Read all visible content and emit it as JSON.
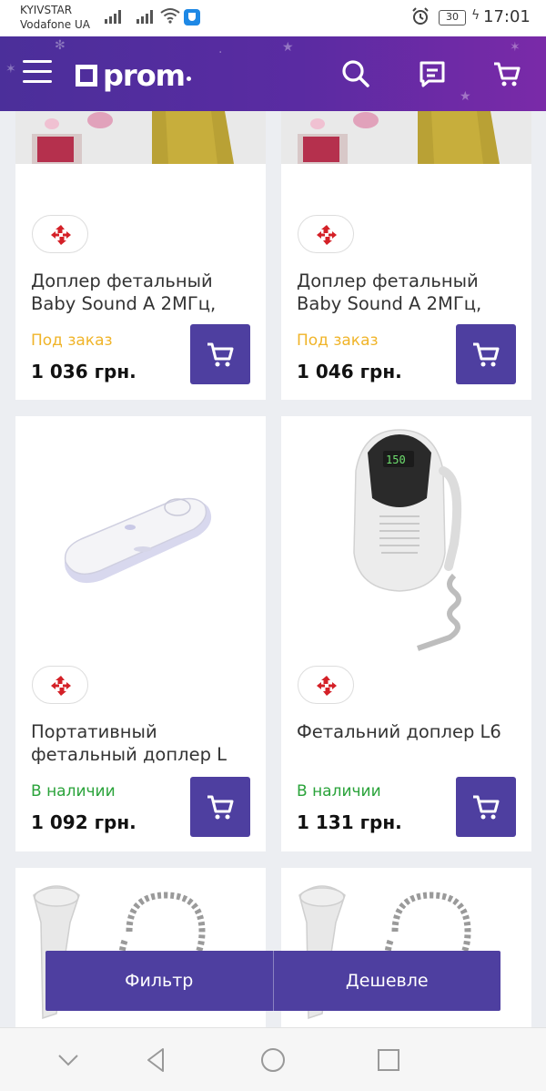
{
  "status_bar": {
    "carrier_1": "KYIVSTAR",
    "carrier_2": "Vodafone UA",
    "battery": "30",
    "time": "17:01"
  },
  "header": {
    "logo": "prom",
    "icons": [
      "menu-icon",
      "search-icon",
      "messages-icon",
      "cart-icon"
    ]
  },
  "products": [
    {
      "title": "Доплер фетальный\nBaby Sound A 2МГц,",
      "status": "Под заказ",
      "status_type": "order",
      "price": "1 036 грн."
    },
    {
      "title": "Доплер фетальный\nBaby Sound A 2МГц,",
      "status": "Под заказ",
      "status_type": "order",
      "price": "1 046 грн."
    },
    {
      "title": "Портативный\nфетальный доплер L",
      "status": "В наличии",
      "status_type": "stock",
      "price": "1 092 грн."
    },
    {
      "title": "Фетальний доплер L6",
      "status": "В наличии",
      "status_type": "stock",
      "price": "1 131 грн."
    }
  ],
  "actions": {
    "filter": "Фильтр",
    "sort": "Дешевле"
  },
  "colors": {
    "brand": "#4e3fa0",
    "in_stock": "#2aa33a",
    "on_order": "#f0b429"
  }
}
